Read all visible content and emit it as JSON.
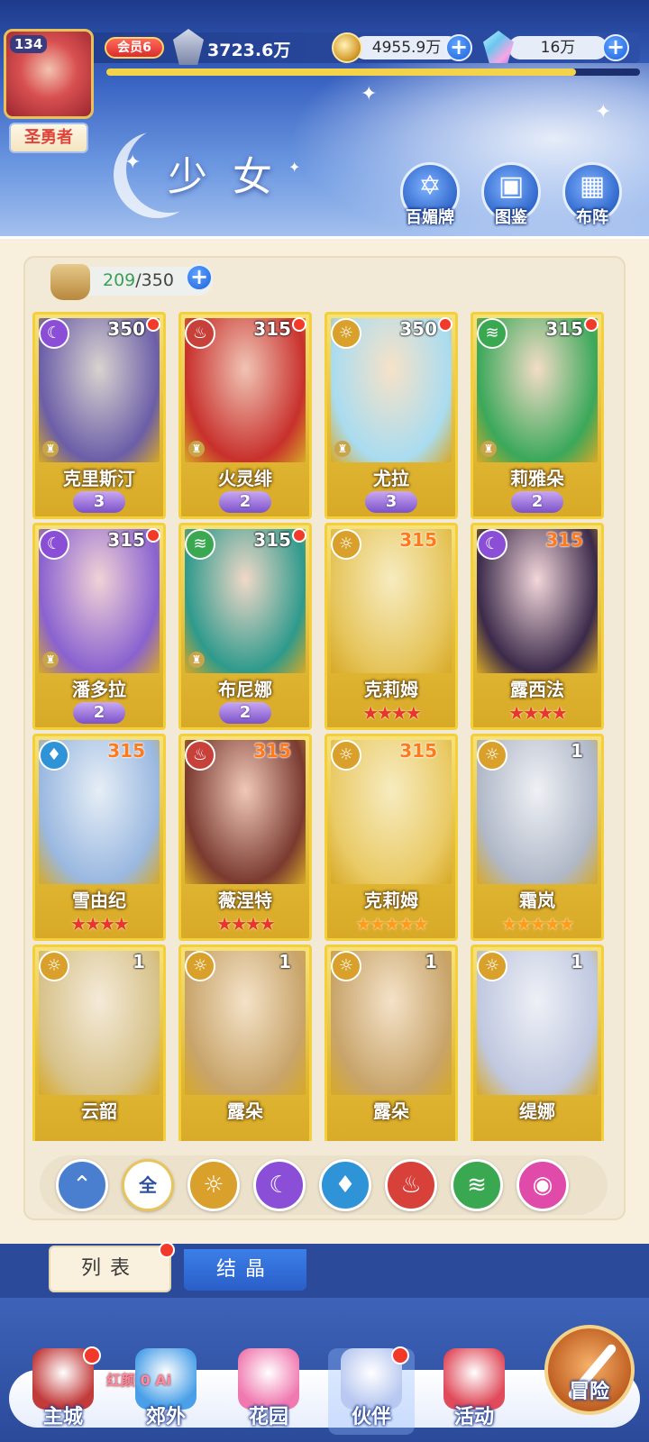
{
  "header": {
    "player_level": "134",
    "rank_title": "圣勇者",
    "vip_label": "会员6",
    "power": "3723.6万",
    "coins": "4955.9万",
    "gems": "16万",
    "exp_progress": 0.88
  },
  "page": {
    "title": "少女",
    "top_buttons": [
      {
        "label": "百媚牌",
        "icon": "card-deck-icon"
      },
      {
        "label": "图鉴",
        "icon": "book-icon"
      },
      {
        "label": "布阵",
        "icon": "formation-grid-icon"
      }
    ]
  },
  "roster": {
    "current": "209",
    "max": "350",
    "separator": "/"
  },
  "cards": [
    {
      "name": "克里斯汀",
      "level": "350",
      "element": "moon",
      "stars": "3",
      "rank_type": "wings",
      "dot": true,
      "chess": true
    },
    {
      "name": "火灵绯",
      "level": "315",
      "element": "fire",
      "stars": "2",
      "rank_type": "wings",
      "dot": true,
      "chess": true
    },
    {
      "name": "尤拉",
      "level": "350",
      "element": "light",
      "stars": "3",
      "rank_type": "wings",
      "dot": true,
      "chess": true
    },
    {
      "name": "莉雅朵",
      "level": "315",
      "element": "wind",
      "stars": "2",
      "rank_type": "wings",
      "dot": true,
      "chess": true
    },
    {
      "name": "潘多拉",
      "level": "315",
      "element": "moon",
      "stars": "2",
      "rank_type": "wings",
      "dot": true,
      "chess": true
    },
    {
      "name": "布尼娜",
      "level": "315",
      "element": "wind",
      "stars": "2",
      "rank_type": "wings",
      "dot": true,
      "chess": true
    },
    {
      "name": "克莉姆",
      "level": "315",
      "element": "light",
      "stars": "★★★★",
      "rank_type": "red",
      "dot": false,
      "chess": false
    },
    {
      "name": "露西法",
      "level": "315",
      "element": "moon",
      "stars": "★★★★",
      "rank_type": "red",
      "dot": false,
      "chess": false
    },
    {
      "name": "雪由纪",
      "level": "315",
      "element": "water",
      "stars": "★★★★",
      "rank_type": "red",
      "dot": false,
      "chess": false
    },
    {
      "name": "薇涅特",
      "level": "315",
      "element": "fire",
      "stars": "★★★★",
      "rank_type": "red",
      "dot": false,
      "chess": false
    },
    {
      "name": "克莉姆",
      "level": "315",
      "element": "light",
      "stars": "★★★★★",
      "rank_type": "gold",
      "dot": false,
      "chess": false
    },
    {
      "name": "霜岚",
      "level": "1",
      "element": "light",
      "stars": "★★★★★",
      "rank_type": "gold",
      "dot": false,
      "chess": false
    },
    {
      "name": "云韶",
      "level": "1",
      "element": "light",
      "stars": "",
      "rank_type": "none",
      "dot": false,
      "chess": false
    },
    {
      "name": "露朵",
      "level": "1",
      "element": "light",
      "stars": "",
      "rank_type": "none",
      "dot": false,
      "chess": false
    },
    {
      "name": "露朵",
      "level": "1",
      "element": "light",
      "stars": "",
      "rank_type": "none",
      "dot": false,
      "chess": false
    },
    {
      "name": "缇娜",
      "level": "1",
      "element": "light",
      "stars": "",
      "rank_type": "none",
      "dot": false,
      "chess": false
    }
  ],
  "filters": [
    {
      "key": "cleave",
      "label": "",
      "icon": "cleave-icon",
      "color": "#4a7fd0"
    },
    {
      "key": "all",
      "label": "全",
      "icon": "all-icon",
      "color": "#ffffff"
    },
    {
      "key": "light",
      "label": "",
      "icon": "sun-icon",
      "color": "#d9a12b"
    },
    {
      "key": "moon",
      "label": "",
      "icon": "moon-icon",
      "color": "#8a4fd6"
    },
    {
      "key": "water",
      "label": "",
      "icon": "water-drop-icon",
      "color": "#2f93d8"
    },
    {
      "key": "fire",
      "label": "",
      "icon": "fire-icon",
      "color": "#d8403a"
    },
    {
      "key": "wind",
      "label": "",
      "icon": "wind-icon",
      "color": "#3aa850"
    },
    {
      "key": "heart",
      "label": "",
      "icon": "heart-orb-icon",
      "color": "#e04aa8"
    }
  ],
  "tabs": {
    "list": "列表",
    "crystal": "结晶"
  },
  "event_text": "红颜 0 Ai",
  "nav": [
    {
      "label": "主城",
      "icon": "castle-icon",
      "dot": true,
      "color": "#c23a3a"
    },
    {
      "label": "郊外",
      "icon": "portal-icon",
      "dot": false,
      "color": "#4aa0e8"
    },
    {
      "label": "花园",
      "icon": "heart-garden-icon",
      "dot": false,
      "color": "#f07ab0"
    },
    {
      "label": "伙伴",
      "icon": "partner-icon",
      "dot": true,
      "color": "#b8c8f0"
    },
    {
      "label": "活动",
      "icon": "gift-icon",
      "dot": false,
      "color": "#e04a5a"
    },
    {
      "label": "冒险",
      "icon": "compass-icon",
      "dot": false,
      "color": "#d8702a"
    }
  ],
  "element_colors": {
    "moon": "#8a4fd6",
    "fire": "#c8403a",
    "light": "#d9a12b",
    "wind": "#3aa850",
    "water": "#2f93d8"
  },
  "element_glyphs": {
    "moon": "☾",
    "fire": "♨",
    "light": "☼",
    "wind": "≋",
    "water": "♦"
  }
}
